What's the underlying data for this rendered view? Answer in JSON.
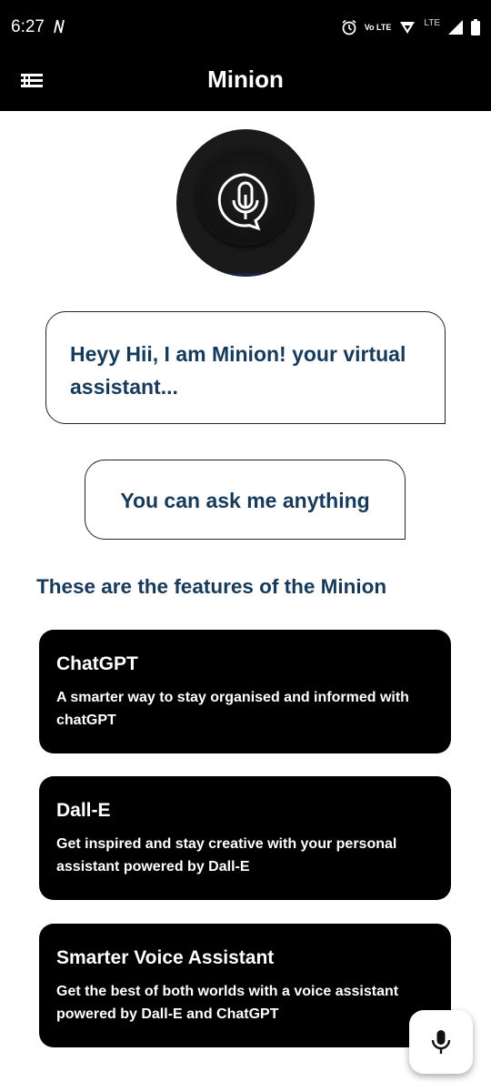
{
  "status_bar": {
    "time": "6:27",
    "network_label": "LTE",
    "volte_label": "Vo LTE"
  },
  "app_bar": {
    "title": "Minion",
    "menu_icon": "menu-icon"
  },
  "assistant": {
    "avatar_icon": "microphone-chat-icon"
  },
  "bubbles": [
    {
      "text": "Heyy Hii, I am Minion! your virtual assistant..."
    },
    {
      "text": "You can ask me anything"
    }
  ],
  "features": {
    "heading": "These are the features of the Minion",
    "cards": [
      {
        "title": "ChatGPT",
        "description": "A smarter way to stay organised and informed with chatGPT"
      },
      {
        "title": "Dall-E",
        "description": "Get inspired and stay creative with your personal assistant powered by Dall-E"
      },
      {
        "title": "Smarter Voice Assistant",
        "description": "Get the best of both worlds with a voice assistant powered by Dall-E and ChatGPT"
      }
    ]
  },
  "fab": {
    "icon": "microphone-icon"
  },
  "colors": {
    "bar_background": "#000000",
    "accent_text": "#173a5a",
    "card_background": "#000000"
  }
}
